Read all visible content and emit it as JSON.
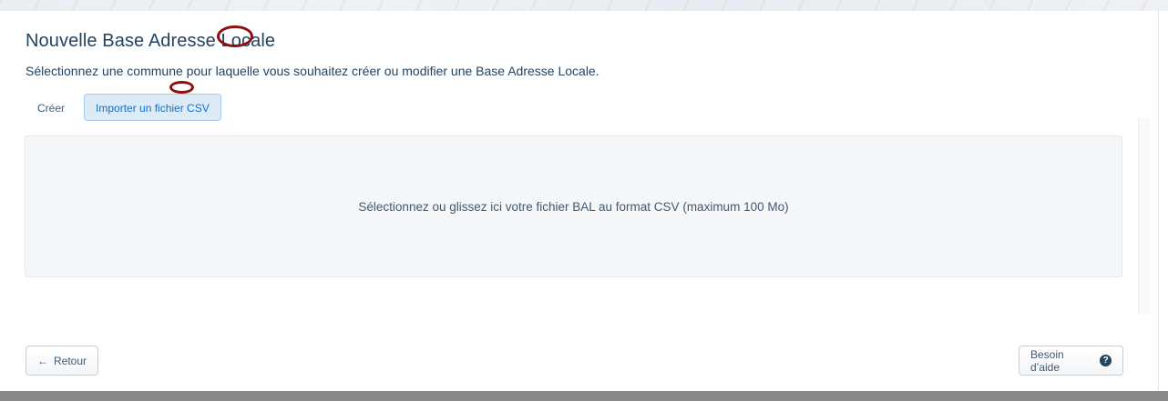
{
  "dialog": {
    "title": "Nouvelle Base Adresse Locale",
    "subtitle": "Sélectionnez une commune pour laquelle vous souhaitez créer ou modifier une Base Adresse Locale."
  },
  "tabs": [
    {
      "label": "Créer",
      "active": false
    },
    {
      "label": "Importer un fichier CSV",
      "active": true
    }
  ],
  "dropzone": {
    "text": "Sélectionnez ou glissez ici votre fichier BAL au format CSV (maximum 100 Mo)"
  },
  "footer": {
    "back_icon": "←",
    "back_label": "Retour",
    "help_label": "Besoin d’aide",
    "help_icon": "?"
  },
  "colors": {
    "title": "#234361",
    "active_tab_text": "#1070ca",
    "active_tab_bg": "#ddebf7",
    "annotation": "#8b0f12"
  }
}
